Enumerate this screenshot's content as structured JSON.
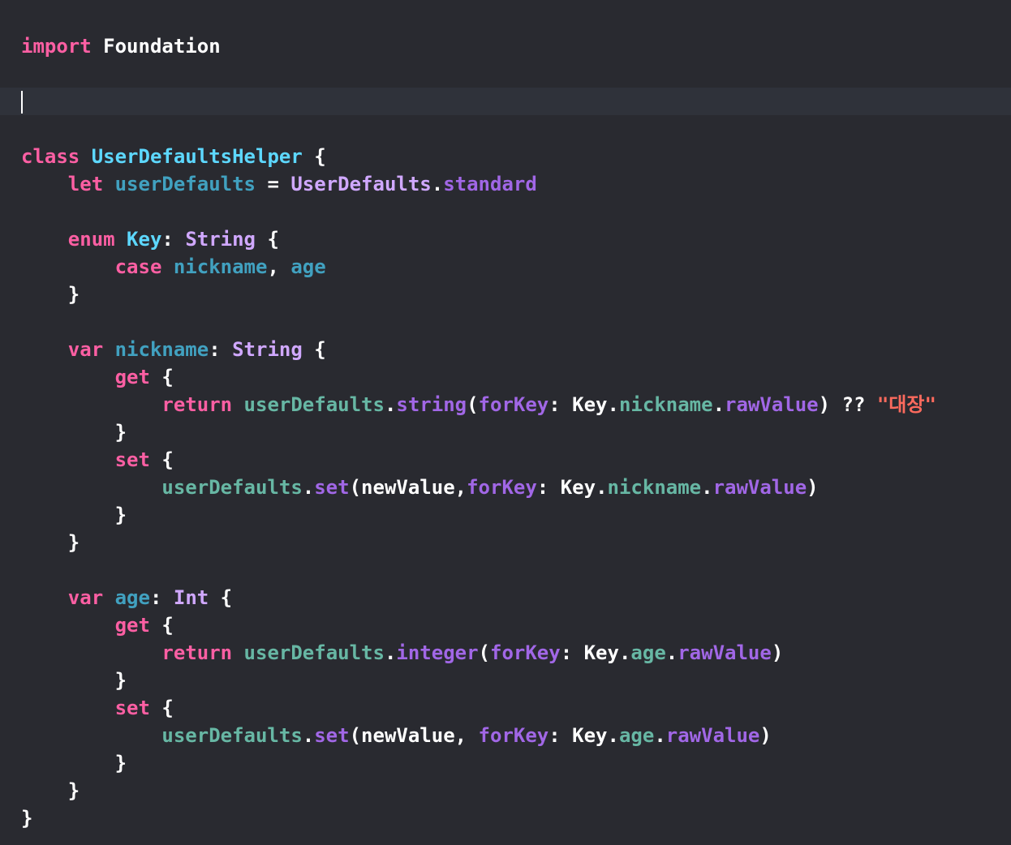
{
  "editor": {
    "language": "Swift",
    "theme": "Default (Dark)",
    "cursor_line": 2,
    "colors": {
      "background": "#292a30",
      "current_line": "#2f323a",
      "keyword": "#fc5fa3",
      "type_declaration": "#5dd8ff",
      "other_declaration": "#41a1c0",
      "type": "#d0a8ff",
      "member": "#a167e6",
      "project_symbol": "#67b7a4",
      "string": "#fc6a5d",
      "plain": "#ffffff"
    },
    "lines": [
      {
        "current": false,
        "tokens": [
          {
            "t": "import",
            "c": "kw"
          },
          {
            "t": " Foundation",
            "c": "plain"
          }
        ]
      },
      {
        "current": false,
        "tokens": []
      },
      {
        "current": true,
        "tokens": []
      },
      {
        "current": false,
        "tokens": []
      },
      {
        "current": false,
        "tokens": [
          {
            "t": "class",
            "c": "kw"
          },
          {
            "t": " ",
            "c": "plain"
          },
          {
            "t": "UserDefaultsHelper",
            "c": "tdecl"
          },
          {
            "t": " {",
            "c": "plain"
          }
        ]
      },
      {
        "current": false,
        "tokens": [
          {
            "t": "    ",
            "c": "plain"
          },
          {
            "t": "let",
            "c": "kw"
          },
          {
            "t": " ",
            "c": "plain"
          },
          {
            "t": "userDefaults",
            "c": "vdecl"
          },
          {
            "t": " = ",
            "c": "plain"
          },
          {
            "t": "UserDefaults",
            "c": "type"
          },
          {
            "t": ".",
            "c": "plain"
          },
          {
            "t": "standard",
            "c": "mem"
          }
        ]
      },
      {
        "current": false,
        "tokens": []
      },
      {
        "current": false,
        "tokens": [
          {
            "t": "    ",
            "c": "plain"
          },
          {
            "t": "enum",
            "c": "kw"
          },
          {
            "t": " ",
            "c": "plain"
          },
          {
            "t": "Key",
            "c": "tdecl"
          },
          {
            "t": ": ",
            "c": "plain"
          },
          {
            "t": "String",
            "c": "type"
          },
          {
            "t": " {",
            "c": "plain"
          }
        ]
      },
      {
        "current": false,
        "tokens": [
          {
            "t": "        ",
            "c": "plain"
          },
          {
            "t": "case",
            "c": "kw"
          },
          {
            "t": " ",
            "c": "plain"
          },
          {
            "t": "nickname",
            "c": "vdecl"
          },
          {
            "t": ", ",
            "c": "plain"
          },
          {
            "t": "age",
            "c": "vdecl"
          }
        ]
      },
      {
        "current": false,
        "tokens": [
          {
            "t": "    }",
            "c": "plain"
          }
        ]
      },
      {
        "current": false,
        "tokens": []
      },
      {
        "current": false,
        "tokens": [
          {
            "t": "    ",
            "c": "plain"
          },
          {
            "t": "var",
            "c": "kw"
          },
          {
            "t": " ",
            "c": "plain"
          },
          {
            "t": "nickname",
            "c": "vdecl"
          },
          {
            "t": ": ",
            "c": "plain"
          },
          {
            "t": "String",
            "c": "type"
          },
          {
            "t": " {",
            "c": "plain"
          }
        ]
      },
      {
        "current": false,
        "tokens": [
          {
            "t": "        ",
            "c": "plain"
          },
          {
            "t": "get",
            "c": "kw"
          },
          {
            "t": " {",
            "c": "plain"
          }
        ]
      },
      {
        "current": false,
        "tokens": [
          {
            "t": "            ",
            "c": "plain"
          },
          {
            "t": "return",
            "c": "kw"
          },
          {
            "t": " ",
            "c": "plain"
          },
          {
            "t": "userDefaults",
            "c": "pvar"
          },
          {
            "t": ".",
            "c": "plain"
          },
          {
            "t": "string",
            "c": "mem"
          },
          {
            "t": "(",
            "c": "plain"
          },
          {
            "t": "forKey",
            "c": "mem"
          },
          {
            "t": ": ",
            "c": "plain"
          },
          {
            "t": "Key",
            "c": "plain"
          },
          {
            "t": ".",
            "c": "plain"
          },
          {
            "t": "nickname",
            "c": "pvar"
          },
          {
            "t": ".",
            "c": "plain"
          },
          {
            "t": "rawValue",
            "c": "mem"
          },
          {
            "t": ") ?? ",
            "c": "plain"
          },
          {
            "t": "\"대장\"",
            "c": "str"
          }
        ]
      },
      {
        "current": false,
        "tokens": [
          {
            "t": "        }",
            "c": "plain"
          }
        ]
      },
      {
        "current": false,
        "tokens": [
          {
            "t": "        ",
            "c": "plain"
          },
          {
            "t": "set",
            "c": "kw"
          },
          {
            "t": " {",
            "c": "plain"
          }
        ]
      },
      {
        "current": false,
        "tokens": [
          {
            "t": "            ",
            "c": "plain"
          },
          {
            "t": "userDefaults",
            "c": "pvar"
          },
          {
            "t": ".",
            "c": "plain"
          },
          {
            "t": "set",
            "c": "mem"
          },
          {
            "t": "(newValue,",
            "c": "plain"
          },
          {
            "t": "forKey",
            "c": "mem"
          },
          {
            "t": ": ",
            "c": "plain"
          },
          {
            "t": "Key",
            "c": "plain"
          },
          {
            "t": ".",
            "c": "plain"
          },
          {
            "t": "nickname",
            "c": "pvar"
          },
          {
            "t": ".",
            "c": "plain"
          },
          {
            "t": "rawValue",
            "c": "mem"
          },
          {
            "t": ")",
            "c": "plain"
          }
        ]
      },
      {
        "current": false,
        "tokens": [
          {
            "t": "        }",
            "c": "plain"
          }
        ]
      },
      {
        "current": false,
        "tokens": [
          {
            "t": "    }",
            "c": "plain"
          }
        ]
      },
      {
        "current": false,
        "tokens": []
      },
      {
        "current": false,
        "tokens": [
          {
            "t": "    ",
            "c": "plain"
          },
          {
            "t": "var",
            "c": "kw"
          },
          {
            "t": " ",
            "c": "plain"
          },
          {
            "t": "age",
            "c": "vdecl"
          },
          {
            "t": ": ",
            "c": "plain"
          },
          {
            "t": "Int",
            "c": "type"
          },
          {
            "t": " {",
            "c": "plain"
          }
        ]
      },
      {
        "current": false,
        "tokens": [
          {
            "t": "        ",
            "c": "plain"
          },
          {
            "t": "get",
            "c": "kw"
          },
          {
            "t": " {",
            "c": "plain"
          }
        ]
      },
      {
        "current": false,
        "tokens": [
          {
            "t": "            ",
            "c": "plain"
          },
          {
            "t": "return",
            "c": "kw"
          },
          {
            "t": " ",
            "c": "plain"
          },
          {
            "t": "userDefaults",
            "c": "pvar"
          },
          {
            "t": ".",
            "c": "plain"
          },
          {
            "t": "integer",
            "c": "mem"
          },
          {
            "t": "(",
            "c": "plain"
          },
          {
            "t": "forKey",
            "c": "mem"
          },
          {
            "t": ": ",
            "c": "plain"
          },
          {
            "t": "Key",
            "c": "plain"
          },
          {
            "t": ".",
            "c": "plain"
          },
          {
            "t": "age",
            "c": "pvar"
          },
          {
            "t": ".",
            "c": "plain"
          },
          {
            "t": "rawValue",
            "c": "mem"
          },
          {
            "t": ")",
            "c": "plain"
          }
        ]
      },
      {
        "current": false,
        "tokens": [
          {
            "t": "        }",
            "c": "plain"
          }
        ]
      },
      {
        "current": false,
        "tokens": [
          {
            "t": "        ",
            "c": "plain"
          },
          {
            "t": "set",
            "c": "kw"
          },
          {
            "t": " {",
            "c": "plain"
          }
        ]
      },
      {
        "current": false,
        "tokens": [
          {
            "t": "            ",
            "c": "plain"
          },
          {
            "t": "userDefaults",
            "c": "pvar"
          },
          {
            "t": ".",
            "c": "plain"
          },
          {
            "t": "set",
            "c": "mem"
          },
          {
            "t": "(newValue, ",
            "c": "plain"
          },
          {
            "t": "forKey",
            "c": "mem"
          },
          {
            "t": ": ",
            "c": "plain"
          },
          {
            "t": "Key",
            "c": "plain"
          },
          {
            "t": ".",
            "c": "plain"
          },
          {
            "t": "age",
            "c": "pvar"
          },
          {
            "t": ".",
            "c": "plain"
          },
          {
            "t": "rawValue",
            "c": "mem"
          },
          {
            "t": ")",
            "c": "plain"
          }
        ]
      },
      {
        "current": false,
        "tokens": [
          {
            "t": "        }",
            "c": "plain"
          }
        ]
      },
      {
        "current": false,
        "tokens": [
          {
            "t": "    }",
            "c": "plain"
          }
        ]
      },
      {
        "current": false,
        "tokens": [
          {
            "t": "}",
            "c": "plain"
          }
        ]
      }
    ]
  }
}
